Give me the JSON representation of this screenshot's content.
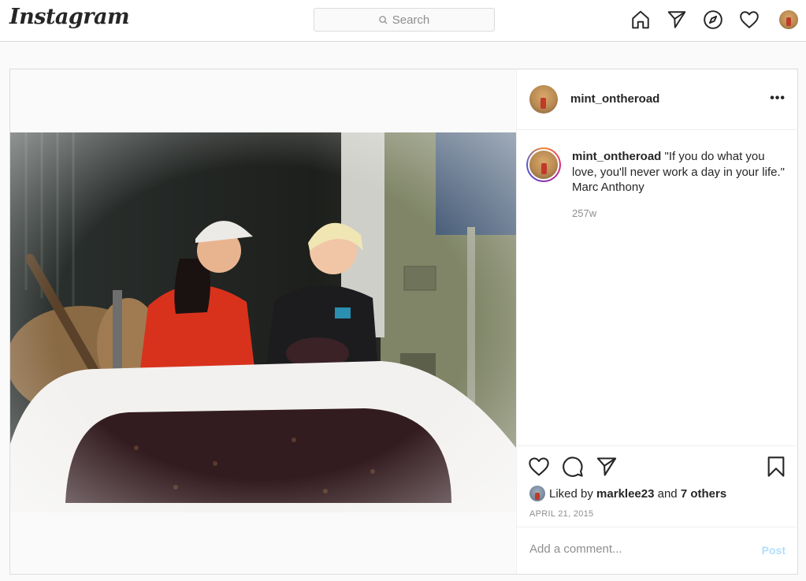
{
  "nav": {
    "logo": "Instagram",
    "search_placeholder": "Search",
    "icons": [
      "home-icon",
      "direct-icon",
      "explore-icon",
      "activity-heart-icon",
      "profile-avatar"
    ]
  },
  "post": {
    "username": "mint_ontheroad",
    "more_label": "•••",
    "caption": {
      "username": "mint_ontheroad",
      "text": "\"If you do what you love, you'll never work a day in your life.\" Marc Anthony"
    },
    "time_ago": "257w",
    "likes": {
      "prefix": "Liked by",
      "user": "marklee23",
      "joiner": "and",
      "others": "7 others"
    },
    "date": "APRIL 21, 2015",
    "comment_placeholder": "Add a comment...",
    "post_button": "Post"
  },
  "colors": {
    "accent_blue_disabled": "#b2dffc",
    "border": "#dbdbdb",
    "muted_text": "#8e8e8e",
    "text": "#262626"
  }
}
